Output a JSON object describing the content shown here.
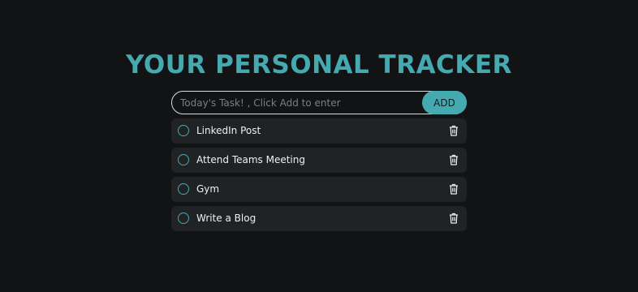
{
  "header": {
    "title": "YOUR PERSONAL TRACKER"
  },
  "input": {
    "placeholder": "Today's Task! , Click Add to enter",
    "value": "",
    "add_label": "ADD"
  },
  "tasks": [
    {
      "label": "LinkedIn Post",
      "done": false
    },
    {
      "label": "Attend Teams Meeting",
      "done": false
    },
    {
      "label": "Gym",
      "done": false
    },
    {
      "label": "Write a Blog",
      "done": false
    }
  ],
  "icons": {
    "check": "circle-outline",
    "delete": "trash-icon"
  },
  "colors": {
    "background": "#121314",
    "accent": "#45aab0",
    "card": "#202224",
    "text": "#eef0f2"
  }
}
